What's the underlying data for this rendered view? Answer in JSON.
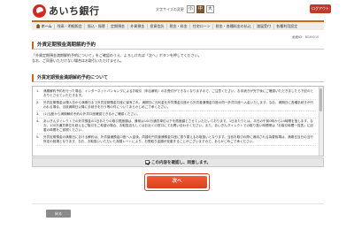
{
  "header": {
    "bank_name": "あいち銀行",
    "font_size_label": "文字サイズの変更",
    "font_sizes": [
      "小",
      "中",
      "大"
    ],
    "logout_label": "ログアウト"
  },
  "nav": {
    "items": [
      "ホーム",
      "残高・明細照会",
      "振込・振替",
      "定期預金",
      "外貨預金",
      "投資信託",
      "税金・料金",
      "住宅ローン",
      "税金・各種料金の払込",
      "諸届受付",
      "各種利用設定"
    ]
  },
  "screen_id": "画面ID：BGHI010",
  "title": "外貨定期預金満期解約予約",
  "intro": {
    "line1": "「外貨定期預金満期解約予約について」をご確認のうえ、よろしければ「次へ」ボタンを押してください。",
    "line2": "なお、ご同意いただけない場合はお取引いただけません。"
  },
  "notice": {
    "heading": "外貨定期預金満期解約予約について",
    "items": [
      {
        "num": "1.",
        "text": "満期解約予約を行った場合、インターネットバンキングによるお取引（申込解約）のお受付ができなくなりますので、ご注意ください。お手続きが完了後にご確認いただきましたら下記のとおりとさせていただきます。"
      },
      {
        "num": "2.",
        "text": "外貨定期預金は預入日から満期日まで外貨定期預金口座に保有され、満期日に元利金を外貨預金口座から外貨普通預金口座の同一外貨口座へ入金いたします。なお、満期日に各種手続きが行われる場合、当該満期日以降に手続きを行う等の件についてあらかじめご了承ください。"
      },
      {
        "num": "3.",
        "text": "(1)当座から満期解約予約の外貨口座確認できるかご確認ください。"
      },
      {
        "num": "4.",
        "text": "あいぎんダイレクトでの外貨預金の1日あたりの取引限度額は、通常は100万通貨単位以下を限度額とさせていただいております。1日あたりとは、平日の午前0時から24時間を指します。なお、100万通貨単位を超えるご取引をご希望の場合、お取扱店もしくはお近くの窓口にてお問い合わせください。また、あいぎんダイレクトでの取り扱い時間帯は「お取引時間一覧表」に記載の時間をご参照ください。"
      },
      {
        "num": "5.",
        "text": "外貨定期預金の満期日における解約は、外貨普通預金口座へ入金後、同額を円貨普通預金口座に振り替えるお取扱いとなります。当該お取引の際に適用される為替相場は、満期日当日の当行所定の相場となります。なお、お取扱いいただいた為替レートにより、お受取り金額が変動することがございますので、あらかじめご了承ください。"
      }
    ]
  },
  "agree_label": "この内容を確認し、同意します。",
  "next_label": "次へ",
  "back_label": "戻る"
}
